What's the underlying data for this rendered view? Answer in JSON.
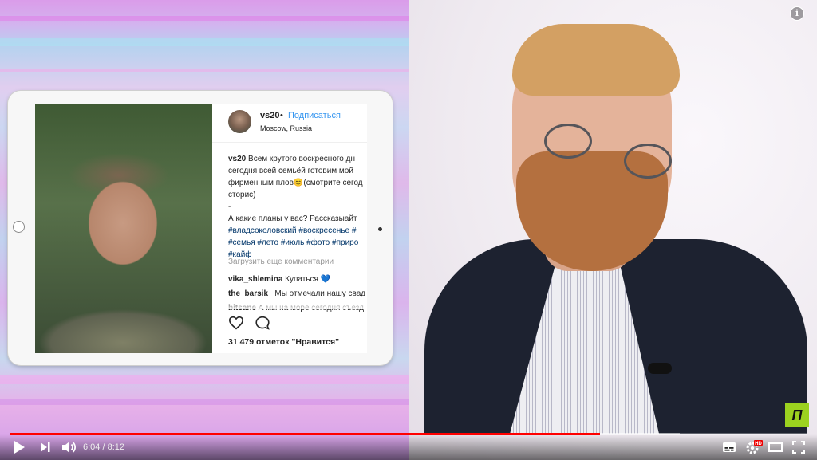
{
  "video": {
    "progress_fraction": 0.74,
    "buffered_fraction": 0.84,
    "current_time": "6:04",
    "separator": " / ",
    "duration": "8:12",
    "channel_logo_text": "П"
  },
  "instagram": {
    "username": "vs20",
    "dot": "•",
    "follow_label": "Подписаться",
    "location": "Moscow, Russia",
    "caption_lines": [
      {
        "user": "vs20",
        "text": " Всем крутого воскресного дн"
      },
      {
        "text": "сегодня всей семьёй готовим мой"
      },
      {
        "text": "фирменным плов😊(смотрите сегод"
      },
      {
        "text": "сторис)"
      },
      {
        "text": "-"
      },
      {
        "text": "А какие планы у вас? Рассказыайт"
      },
      {
        "tag": "#владсоколовский #воскресенье #"
      },
      {
        "tag": "#семья #лето #июль #фото #приро"
      },
      {
        "tag": "#кайф"
      }
    ],
    "load_more": "Загрузить еще комментарии",
    "comments": [
      {
        "user": "vika_shlemina",
        "text": " Купаться 💙"
      },
      {
        "user": "the_barsik_",
        "text": " Мы отмечали нашу свад"
      },
      {
        "user": "bitsane",
        "text": " А мы на море сегодня съезд"
      }
    ],
    "likes": "31 479 отметок \"Нравится\""
  },
  "colors": {
    "progress_red": "#ff0000",
    "instagram_blue": "#3897f0",
    "channel_green": "#9cd21f"
  },
  "icons": [
    "info-icon",
    "play-icon",
    "next-icon",
    "volume-icon",
    "subtitles-icon",
    "settings-hd-icon",
    "theater-mode-icon",
    "fullscreen-icon",
    "heart-icon",
    "comment-icon"
  ]
}
